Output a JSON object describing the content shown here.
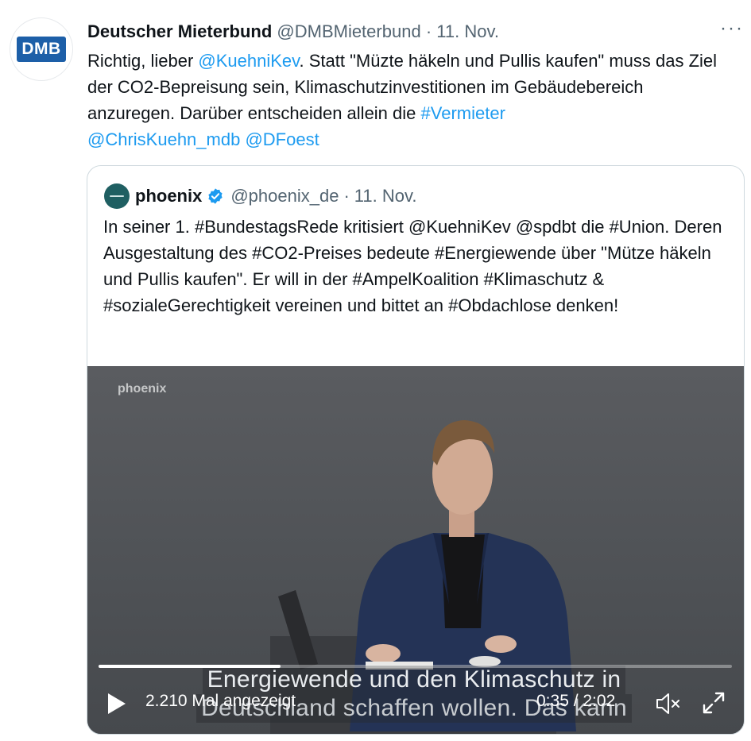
{
  "tweet": {
    "author_name": "Deutscher Mieterbund",
    "handle": "@DMBMieterbund",
    "separator": "·",
    "date": "11. Nov.",
    "more_label": "···",
    "avatar_text": "DMB",
    "text_1": "Richtig, lieber ",
    "mention_1": "@KuehniKev",
    "text_2": ". Statt \"Müzte häkeln und Pullis kaufen\" muss das Ziel der CO2-Bepreisung sein, Klimaschutzinvestitionen im Gebäudebereich anzuregen. Darüber entscheiden allein die ",
    "hashtag_1": "#Vermieter",
    "mention_2": "@ChrisKuehn_mdb",
    "mention_3": "@DFoest"
  },
  "quote": {
    "author_name": "phoenix",
    "handle": "@phoenix_de",
    "separator": "·",
    "date": "11. Nov.",
    "text": "In seiner 1. #BundestagsRede kritisiert @KuehniKev @spdbt die #Union. Deren Ausgestaltung des #CO2-Preises bedeute #Energiewende über \"Mütze häkeln und Pullis kaufen\". Er will in der #AmpelKoalition #Klimaschutz & #sozialeGerechtigkeit vereinen und bittet an #Obdachlose denken!"
  },
  "video": {
    "watermark": "phoenix",
    "caption_line_1": "Energiewende und den Klimaschutz in",
    "caption_line_2": "Deutschland schaffen wollen. Das kann",
    "views": "2.210 Mal angezeigt",
    "time": "0:35 / 2:02",
    "progress_fraction": 0.287
  },
  "colors": {
    "link": "#1d9bf0",
    "muted": "#536471",
    "verified": "#1d9bf0"
  },
  "icons": {
    "verified": "verified-badge-icon",
    "play": "play-icon",
    "mute": "speaker-muted-icon",
    "fullscreen": "fullscreen-icon"
  }
}
